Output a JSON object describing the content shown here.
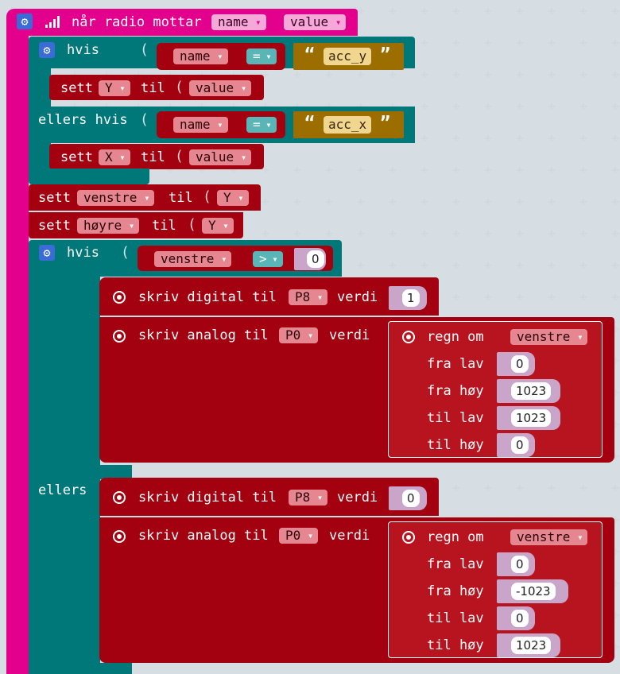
{
  "event": {
    "label": "når radio mottar",
    "param_name": "name",
    "param_value": "value"
  },
  "if1": {
    "hvis": "hvis",
    "var": "name",
    "op": "=",
    "str": "acc_y",
    "sett": "sett",
    "til": "til",
    "set_var": "Y",
    "set_val": "value"
  },
  "elseif1": {
    "label": "ellers hvis",
    "var": "name",
    "op": "=",
    "str": "acc_x",
    "sett": "sett",
    "til": "til",
    "set_var": "X",
    "set_val": "value"
  },
  "set_venstre": {
    "sett": "sett",
    "var": "venstre",
    "til": "til",
    "val": "Y"
  },
  "set_hoyre": {
    "sett": "sett",
    "var": "høyre",
    "til": "til",
    "val": "Y"
  },
  "if2": {
    "hvis": "hvis",
    "var": "venstre",
    "op": ">",
    "num": "0",
    "then": {
      "digital": {
        "label": "skriv digital til",
        "pin": "P8",
        "verdi": "verdi",
        "value": "1"
      },
      "analog": {
        "label": "skriv analog til",
        "pin": "P0",
        "verdi": "verdi",
        "map": {
          "label": "regn om",
          "var": "venstre",
          "fra_lav": "fra lav",
          "fra_lav_val": "0",
          "fra_hoy": "fra høy",
          "fra_hoy_val": "1023",
          "til_lav": "til lav",
          "til_lav_val": "1023",
          "til_hoy": "til høy",
          "til_hoy_val": "0"
        }
      }
    },
    "ellers": "ellers",
    "else": {
      "digital": {
        "label": "skriv digital til",
        "pin": "P8",
        "verdi": "verdi",
        "value": "0"
      },
      "analog": {
        "label": "skriv analog til",
        "pin": "P0",
        "verdi": "verdi",
        "map": {
          "label": "regn om",
          "var": "venstre",
          "fra_lav": "fra lav",
          "fra_lav_val": "0",
          "fra_hoy": "fra høy",
          "fra_hoy_val": "-1023",
          "til_lav": "til lav",
          "til_lav_val": "0",
          "til_hoy": "til høy",
          "til_hoy_val": "1023"
        }
      }
    }
  },
  "colors": {
    "radio": "#e3008c",
    "logic": "#00787a",
    "variables": "#a30010",
    "pins": "#a30010",
    "text": "#9c6e00",
    "workspace": "#e9eef2"
  }
}
